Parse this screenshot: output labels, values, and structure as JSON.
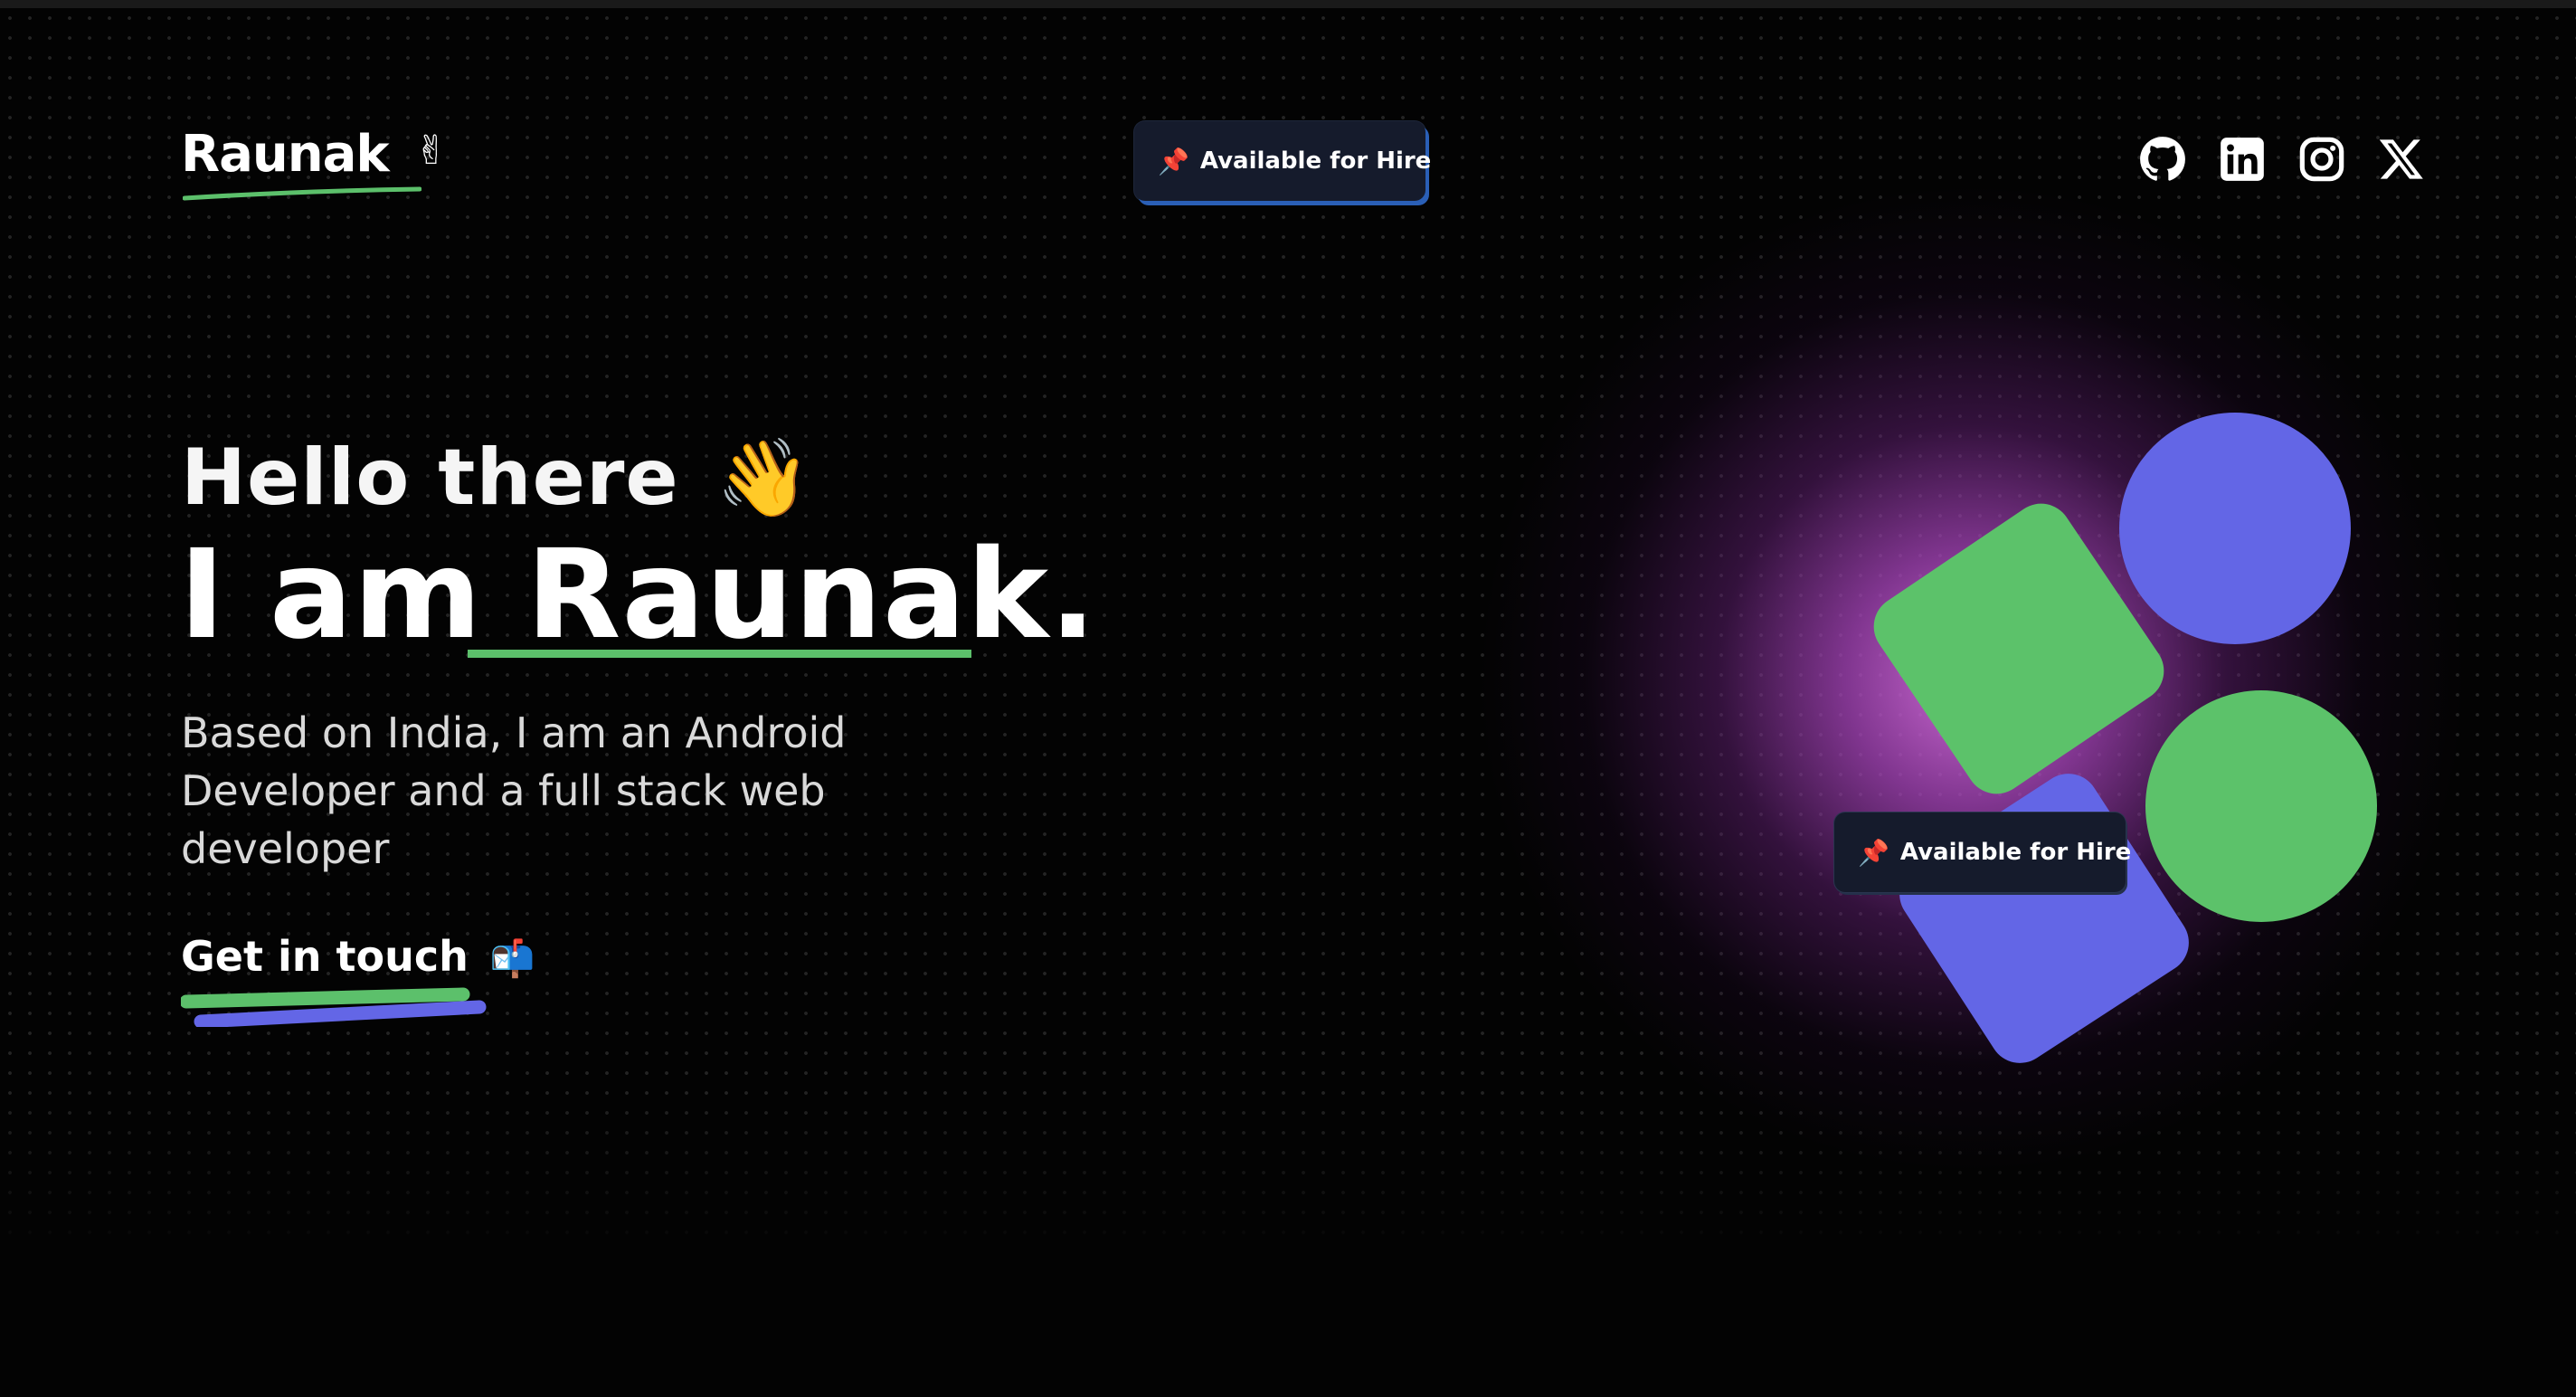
{
  "header": {
    "logo_text": "Raunak",
    "logo_emoji": "✌",
    "hire_badge": {
      "pin": "📌",
      "label": "Available for Hire"
    },
    "social_icons": [
      "github-icon",
      "linkedin-icon",
      "instagram-icon",
      "x-icon"
    ]
  },
  "hero": {
    "greeting": "Hello there",
    "wave_emoji": "👋",
    "intro_prefix": "I am",
    "name": "Raunak.",
    "bio": "Based on India, I am an Android Developer and a full stack web developer",
    "cta_label": "Get in touch",
    "cta_emoji": "📬"
  },
  "illustration": {
    "floating_badge": {
      "pin": "📌",
      "label": "Available for Hire"
    }
  },
  "colors": {
    "background": "#030303",
    "accent_green": "#5cc26a",
    "accent_blue": "#6366e6",
    "glow_pink": "#d46edc",
    "badge_bg": "#151b2c"
  }
}
